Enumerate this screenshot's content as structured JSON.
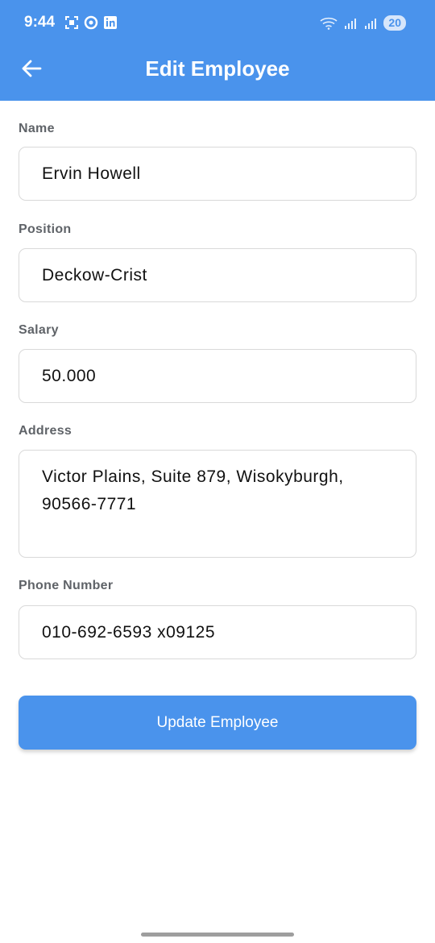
{
  "status_bar": {
    "time": "9:44",
    "battery": "20",
    "icons_left": [
      "screenshot-icon",
      "sync-icon",
      "linkedin-icon"
    ],
    "icons_right": [
      "wifi-icon",
      "signal-icon",
      "signal-icon"
    ]
  },
  "app_bar": {
    "title": "Edit Employee",
    "back_icon": "arrow-left-icon",
    "color": "#4a93ec"
  },
  "form": {
    "name": {
      "label": "Name",
      "value": "Ervin Howell"
    },
    "position": {
      "label": "Position",
      "value": "Deckow-Crist"
    },
    "salary": {
      "label": "Salary",
      "value": "50.000"
    },
    "address": {
      "label": "Address",
      "value": "Victor Plains, Suite 879, Wisokyburgh, 90566-7771"
    },
    "phone": {
      "label": "Phone Number",
      "value": "010-692-6593 x09125"
    }
  },
  "submit": {
    "label": "Update Employee"
  }
}
